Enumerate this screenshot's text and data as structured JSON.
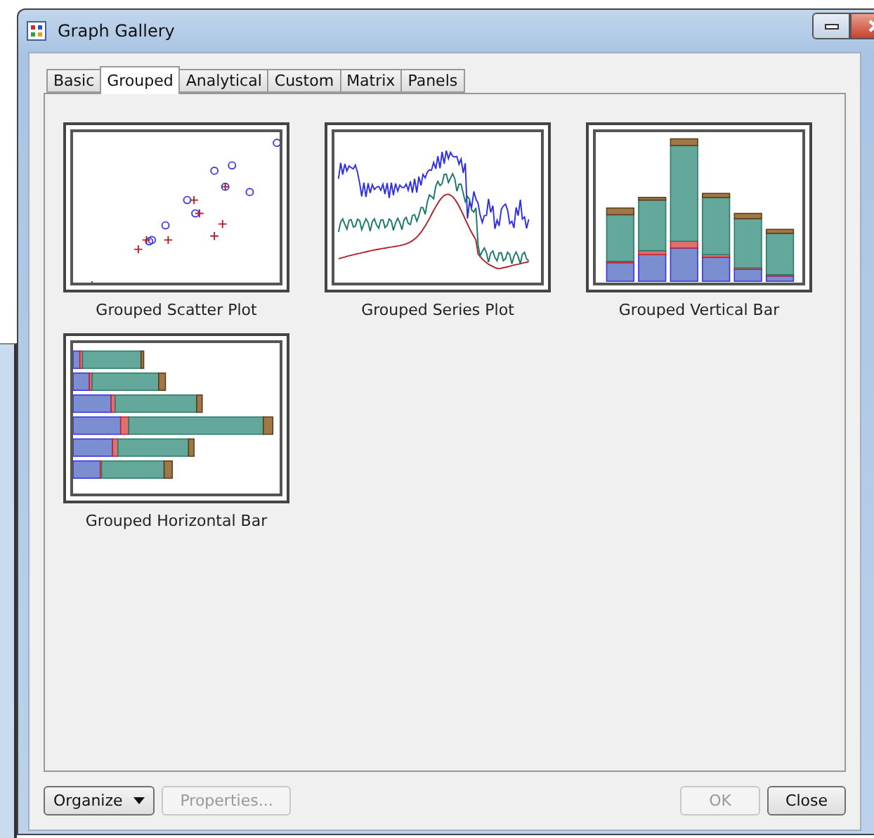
{
  "window": {
    "title": "Graph Gallery"
  },
  "tabs": [
    {
      "label": "Basic",
      "selected": false
    },
    {
      "label": "Grouped",
      "selected": true
    },
    {
      "label": "Analytical",
      "selected": false
    },
    {
      "label": "Custom",
      "selected": false
    },
    {
      "label": "Matrix",
      "selected": false
    },
    {
      "label": "Panels",
      "selected": false
    }
  ],
  "gallery": [
    {
      "title": "Grouped Scatter Plot",
      "kind": "scatter"
    },
    {
      "title": "Grouped Series Plot",
      "kind": "series"
    },
    {
      "title": "Grouped Vertical Bar",
      "kind": "vbar"
    },
    {
      "title": "Grouped Horizontal Bar",
      "kind": "hbar"
    }
  ],
  "buttons_left": [
    {
      "label": "Organize",
      "dropdown": true,
      "disabled": false
    },
    {
      "label": "Properties...",
      "dropdown": false,
      "disabled": true
    }
  ],
  "buttons_right": [
    {
      "label": "OK",
      "disabled": true
    },
    {
      "label": "Close",
      "disabled": false
    }
  ]
}
